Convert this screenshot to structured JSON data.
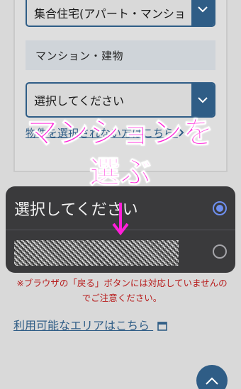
{
  "form": {
    "housing_type_value": "集合住宅(アパート・マンショ",
    "building_label": "マンション・建物",
    "building_select_value": "選択してください",
    "help_link_text": "物件を選択されない方はこちら"
  },
  "overlay": {
    "line1": "マンションを",
    "line2": "選ぶ"
  },
  "dropdown": {
    "options": [
      {
        "label": "選択してください",
        "selected": true
      },
      {
        "label": "",
        "selected": false
      }
    ]
  },
  "notice": "※ブラウザの「戻る」ボタンには対応していませんのでご注意ください。",
  "area_link": "利用可能なエリアはこちら",
  "colors": {
    "accent": "#2f5d86",
    "overlay_text": "#ff1fd8",
    "notice": "#b81c1c",
    "dropdown_bg": "#3a3a3c",
    "radio_selected": "#6e8ff0"
  }
}
